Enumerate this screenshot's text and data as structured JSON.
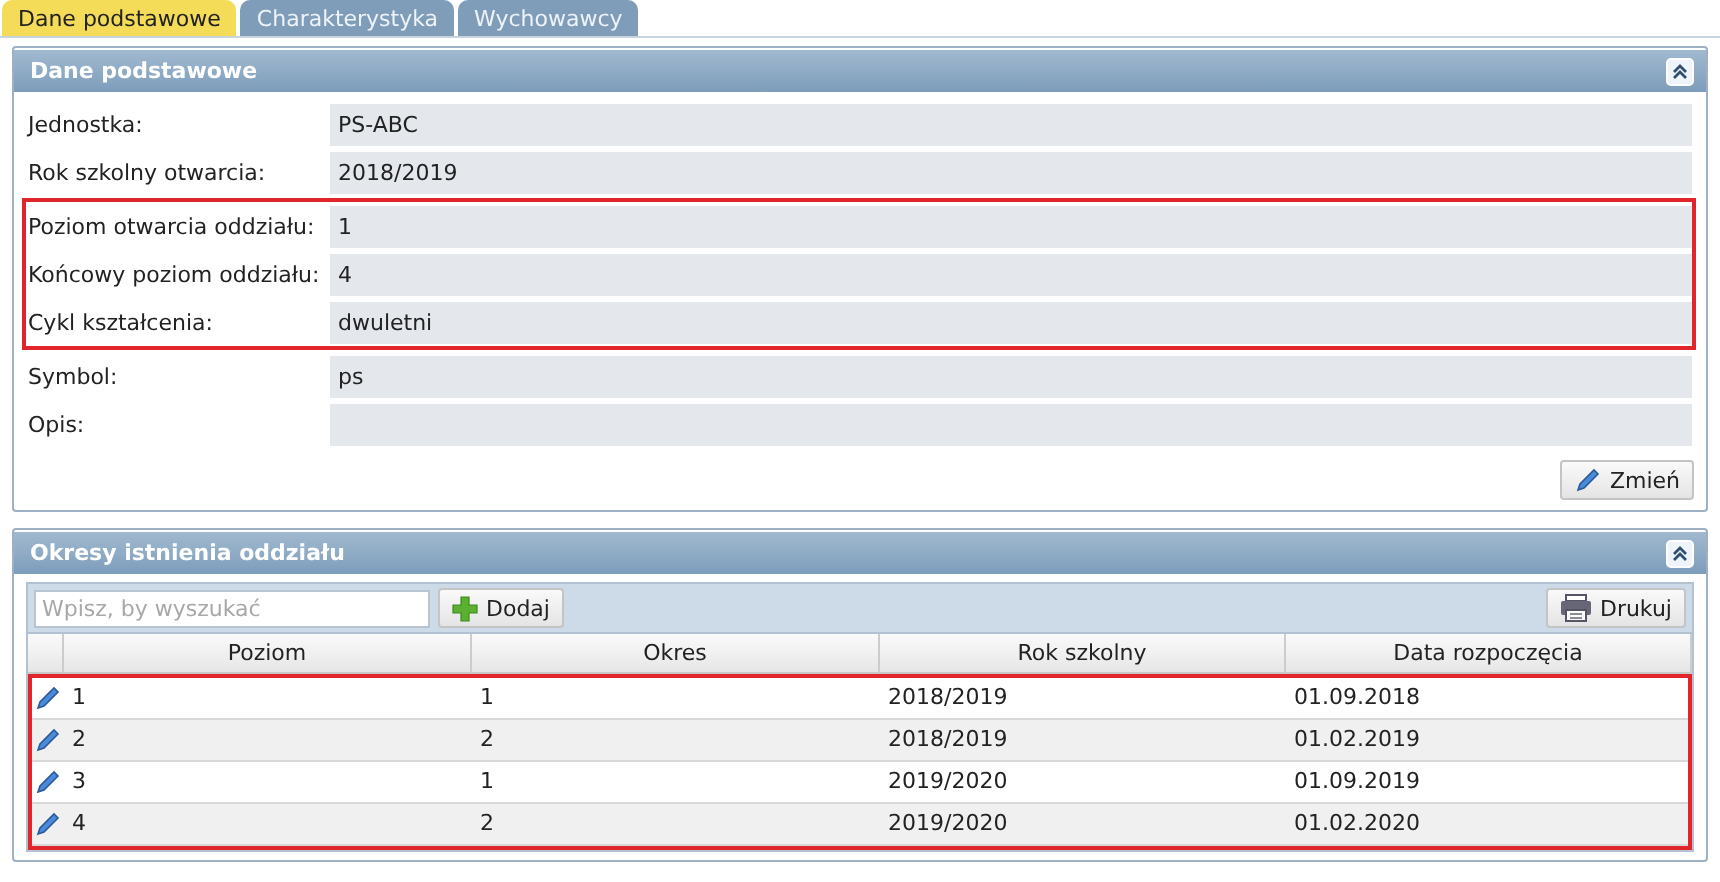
{
  "tabs": [
    {
      "label": "Dane podstawowe",
      "selected": true
    },
    {
      "label": "Charakterystyka",
      "selected": false
    },
    {
      "label": "Wychowawcy",
      "selected": false
    }
  ],
  "details_panel": {
    "title": "Dane podstawowe",
    "field_groups": [
      {
        "highlighted": false,
        "fields": [
          {
            "label": "Jednostka:",
            "value": "PS-ABC"
          },
          {
            "label": "Rok szkolny otwarcia:",
            "value": "2018/2019"
          }
        ]
      },
      {
        "highlighted": true,
        "fields": [
          {
            "label": "Poziom otwarcia oddziału:",
            "value": "1"
          },
          {
            "label": "Końcowy poziom oddziału:",
            "value": "4"
          },
          {
            "label": "Cykl kształcenia:",
            "value": "dwuletni"
          }
        ]
      },
      {
        "highlighted": false,
        "fields": [
          {
            "label": "Symbol:",
            "value": "ps"
          },
          {
            "label": "Opis:"
          }
        ]
      }
    ],
    "edit_button": "Zmień"
  },
  "periods_panel": {
    "title": "Okresy istnienia oddziału",
    "search": {
      "placeholder": "Wpisz, by wyszukać"
    },
    "add_button": "Dodaj",
    "print_button": "Drukuj",
    "table": {
      "columns": [
        "Poziom",
        "Okres",
        "Rok szkolny",
        "Data rozpoczęcia"
      ],
      "highlighted": true,
      "rows": [
        [
          "1",
          "1",
          "2018/2019",
          "01.09.2018"
        ],
        [
          "2",
          "2",
          "2018/2019",
          "01.02.2019"
        ],
        [
          "3",
          "1",
          "2019/2020",
          "01.09.2019"
        ],
        [
          "4",
          "2",
          "2019/2020",
          "01.02.2020"
        ]
      ]
    }
  }
}
